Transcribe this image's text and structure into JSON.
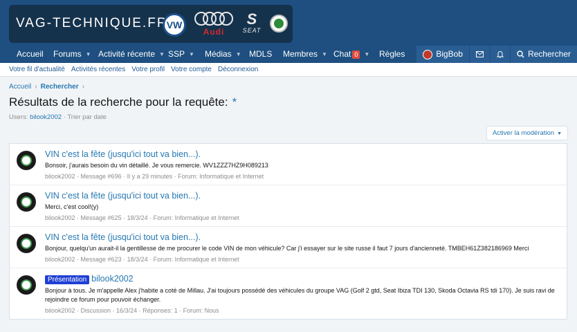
{
  "header": {
    "site_name": "VAG-TECHNIQUE.FR",
    "brands": [
      "VW",
      "Audi",
      "SEAT",
      "Škoda"
    ],
    "audi_text": "Audi",
    "seat_text": "SEAT",
    "vw_text": "VW"
  },
  "nav": {
    "items": [
      {
        "label": "Accueil"
      },
      {
        "label": "Forums"
      },
      {
        "label": "Activité récente"
      },
      {
        "label": "SSP"
      },
      {
        "label": "Médias"
      },
      {
        "label": "MDLS"
      },
      {
        "label": "Membres"
      },
      {
        "label": "Chat"
      },
      {
        "label": "Règles"
      }
    ],
    "chat_count": "0",
    "user": "BigBob",
    "search": "Rechercher"
  },
  "subnav": {
    "items": [
      "Votre fil d'actualité",
      "Activités récentes",
      "Votre profil",
      "Votre compte",
      "Déconnexion"
    ]
  },
  "breadcrumb": {
    "home": "Accueil",
    "current": "Rechercher"
  },
  "page": {
    "title": "Résultats de la recherche pour la requête:",
    "title_star": "*",
    "users_label": "Users:",
    "users_value": "bilook2002",
    "sort": "Trier par date",
    "moderation_button": "Activer la modération"
  },
  "results": [
    {
      "prefix": "",
      "title": "VIN c'est la fête (jusqu'ici tout va bien...).",
      "snippet": "Bonsoir, j'aurais besoin du vin détaillé. Je vous remercie. WV1ZZZ7HZ9H089213",
      "meta": "bilook2002 · Message #696 · Il y a 29 minutes · Forum: Informatique et Internet"
    },
    {
      "prefix": "",
      "title": "VIN c'est la fête (jusqu'ici tout va bien...).",
      "snippet": "Merci, c'est cool!(y)",
      "meta": "bilook2002 · Message #625 · 18/3/24 · Forum: Informatique et Internet"
    },
    {
      "prefix": "",
      "title": "VIN c'est la fête (jusqu'ici tout va bien...).",
      "snippet": "Bonjour, quelqu'un aurait-il la gentillesse de me procurer le code VIN de mon véhicule? Car j'i essayer sur le site russe il faut 7 jours d'ancienneté. TMBEH61Z382186969 Merci",
      "meta": "bilook2002 · Message #623 · 18/3/24 · Forum: Informatique et Internet"
    },
    {
      "prefix": "Présentation",
      "title": "bilook2002",
      "snippet": "Bonjour à tous. Je m'appelle Alex j'habite a coté de Millau. J'ai toujours possédé des véhicules du groupe VAG (Golf 2 gtd, Seat Ibiza TDI 130, Skoda Octavia RS tdi 170). Je suis ravi de rejoindre ce forum pour pouvoir échanger.",
      "meta": "bilook2002 · Discussion · 16/3/24 · Réponses: 1 · Forum: Nous"
    }
  ],
  "colors": {
    "header_bg": "#1e4f80",
    "logo_bg": "#15324c",
    "link": "#2577b1",
    "prefix_bg": "#1f3fd4",
    "badge": "#e24c3f"
  }
}
